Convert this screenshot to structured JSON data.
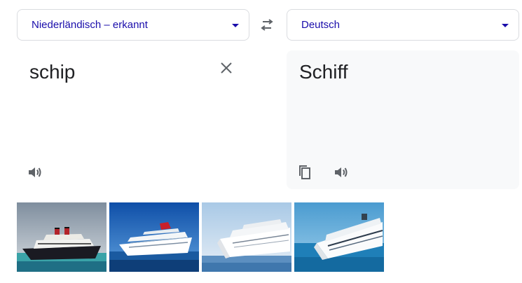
{
  "source": {
    "language_label": "Niederländisch – erkannt",
    "text": "schip"
  },
  "target": {
    "language_label": "Deutsch",
    "text": "Schiff"
  },
  "icons": {
    "swap": "swap-languages-icon",
    "clear": "close-icon",
    "listen": "speaker-icon",
    "copy": "copy-icon",
    "dropdown": "caret-down-icon"
  },
  "colors": {
    "accent": "#1a0dab",
    "icon": "#5f6368",
    "target_bg": "#f8f9fa",
    "border": "#dadce0"
  },
  "images": [
    {
      "name": "ship-image-1"
    },
    {
      "name": "ship-image-2"
    },
    {
      "name": "ship-image-3"
    },
    {
      "name": "ship-image-4"
    }
  ]
}
